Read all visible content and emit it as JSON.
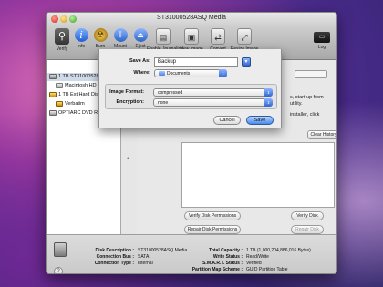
{
  "window": {
    "title": "ST31000528ASQ Media"
  },
  "toolbar": {
    "verify": "Verify",
    "info": "Info",
    "burn": "Burn",
    "mount": "Mount",
    "eject": "Eject",
    "journaling": "Enable Journaling",
    "new_image": "New Image",
    "convert": "Convert",
    "resize": "Resize Image",
    "log": "Log",
    "icons": {
      "verify": "microscope-icon",
      "info": "info-icon",
      "burn": "burn-icon",
      "mount": "mount-icon",
      "eject": "eject-icon",
      "journaling": "journaling-icon",
      "new_image": "new-image-icon",
      "convert": "convert-icon",
      "resize": "resize-image-icon",
      "log": "log-icon"
    }
  },
  "sidebar": {
    "items": [
      {
        "label": "1 TB ST31000528ASQ M",
        "type": "disk",
        "selected": true
      },
      {
        "label": "Macintosh HD",
        "type": "volume"
      },
      {
        "label": "1 TB Ext Hard Disk",
        "type": "external"
      },
      {
        "label": "Verbatim",
        "type": "external-volume"
      },
      {
        "label": "OPTIARC DVD RW",
        "type": "optical"
      }
    ]
  },
  "panel": {
    "peek_1": "s, start up from",
    "peek_2": "utility.",
    "peek_3": "installer, click",
    "clear_history": "Clear History",
    "verify_permissions": "Verify Disk Permissions",
    "repair_permissions": "Repair Disk Permissions",
    "verify_disk": "Verify Disk",
    "repair_disk": "Repair Disk"
  },
  "info": {
    "disk_description_label": "Disk Description :",
    "disk_description": "ST31000528ASQ Media",
    "connection_bus_label": "Connection Bus :",
    "connection_bus": "SATA",
    "connection_type_label": "Connection Type :",
    "connection_type": "Internal",
    "total_capacity_label": "Total Capacity :",
    "total_capacity": "1 TB (1,000,204,886,016 Bytes)",
    "write_status_label": "Write Status :",
    "write_status": "Read/Write",
    "smart_status_label": "S.M.A.R.T. Status :",
    "smart_status": "Verified",
    "partition_scheme_label": "Partition Map Scheme :",
    "partition_scheme": "GUID Partition Table",
    "help": "?"
  },
  "sheet": {
    "save_as_label": "Save As:",
    "save_as_value": "Backup",
    "where_label": "Where:",
    "where_value": "Documents",
    "image_format_label": "Image Format:",
    "image_format_value": "compressed",
    "encryption_label": "Encryption:",
    "encryption_value": "none",
    "cancel": "Cancel",
    "save": "Save"
  },
  "colors": {
    "accent": "#4a8ae8",
    "desktop": "#4a2b8c"
  }
}
